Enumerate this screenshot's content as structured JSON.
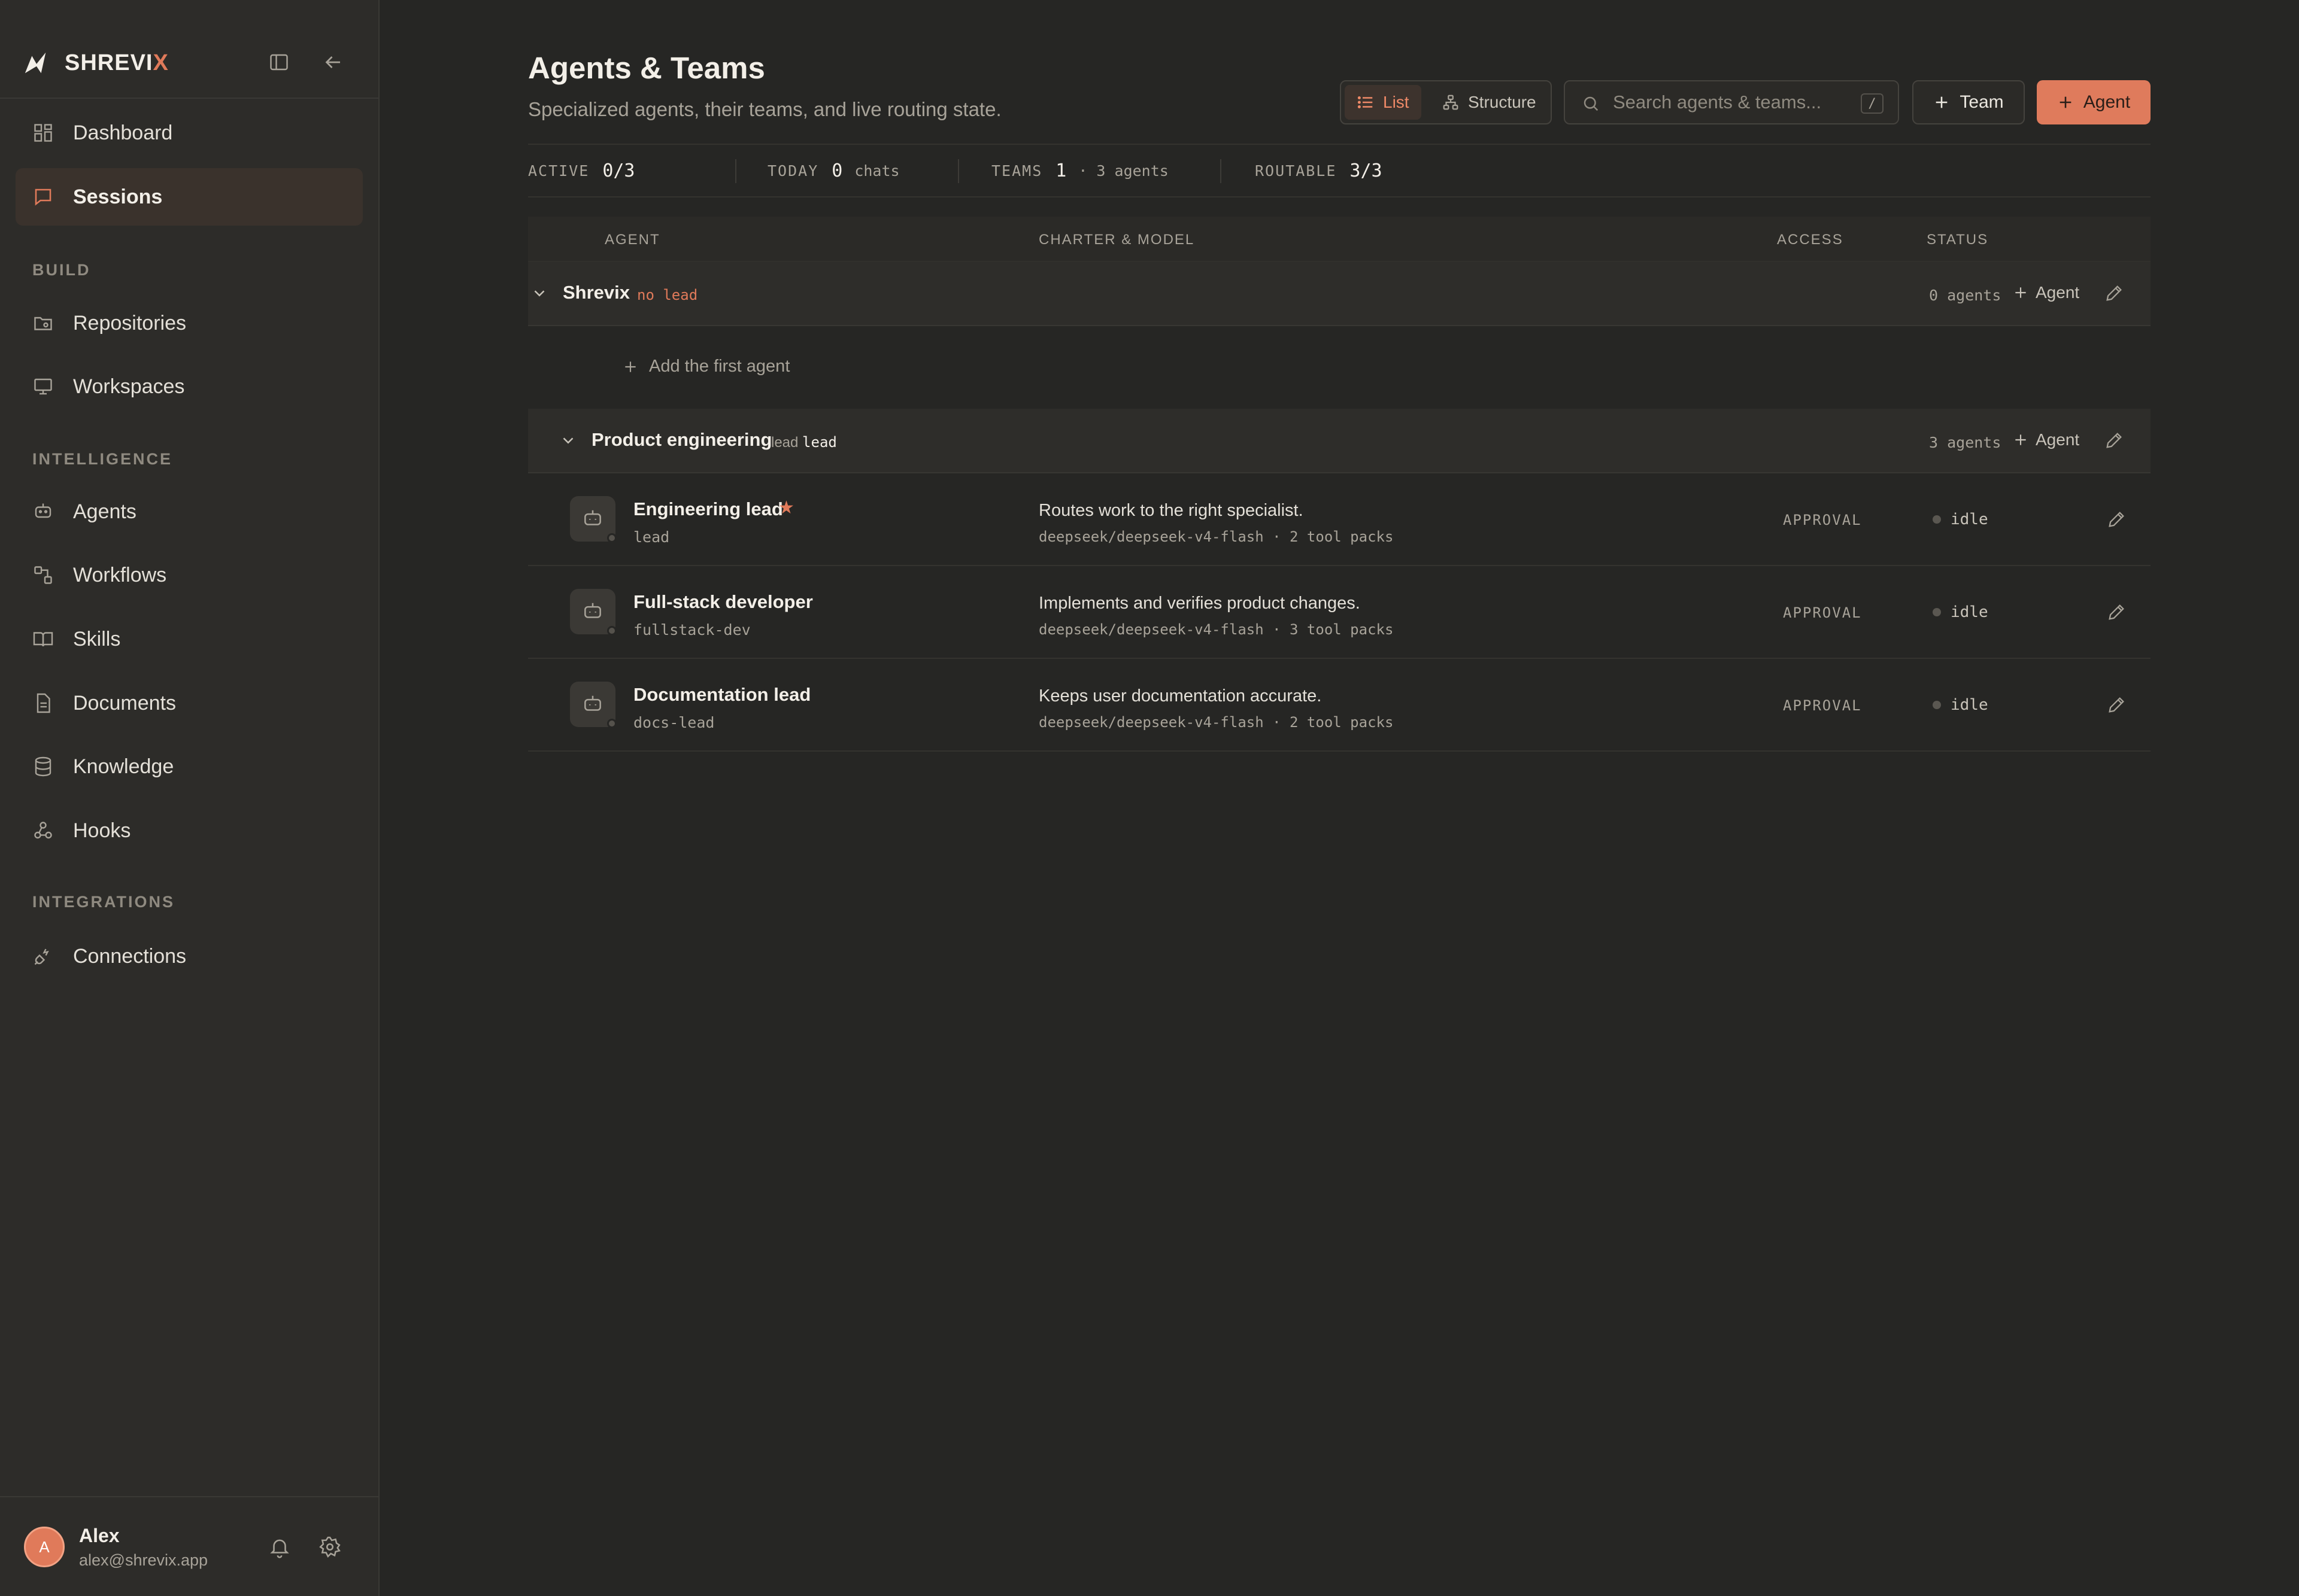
{
  "sidebar": {
    "brand": {
      "name_main": "SHREVI",
      "name_accent": "X"
    },
    "items": [
      {
        "label": "Dashboard"
      },
      {
        "label": "Sessions"
      },
      {
        "label": "Repositories"
      },
      {
        "label": "Workspaces"
      },
      {
        "label": "Agents"
      },
      {
        "label": "Workflows"
      },
      {
        "label": "Skills"
      },
      {
        "label": "Documents"
      },
      {
        "label": "Knowledge"
      },
      {
        "label": "Hooks"
      },
      {
        "label": "Connections"
      }
    ],
    "sections": {
      "build": "BUILD",
      "intelligence": "INTELLIGENCE",
      "integrations": "INTEGRATIONS"
    },
    "user": {
      "initial": "A",
      "name": "Alex",
      "email": "alex@shrevix.app"
    }
  },
  "header": {
    "title": "Agents & Teams",
    "subtitle": "Specialized agents, their teams, and live routing state.",
    "view_toggle": {
      "list": "List",
      "structure": "Structure"
    },
    "search": {
      "placeholder": "Search agents & teams...",
      "shortcut": "/"
    },
    "team_button": "Team",
    "agent_button": "Agent"
  },
  "stats": {
    "active": {
      "label": "ACTIVE",
      "value": "0/3"
    },
    "today": {
      "label": "TODAY",
      "value": "0",
      "suffix": "chats"
    },
    "teams": {
      "label": "TEAMS",
      "value": "1",
      "suffix": "· 3 agents"
    },
    "routable": {
      "label": "ROUTABLE",
      "value": "3/3"
    }
  },
  "table": {
    "columns": {
      "agent": "AGENT",
      "charter": "CHARTER & MODEL",
      "access": "ACCESS",
      "status": "STATUS"
    },
    "teams": [
      {
        "name": "Shrevix",
        "lead": "no lead",
        "count": "0 agents",
        "add_label": "Agent",
        "empty_label": "Add the first agent"
      },
      {
        "name": "Product engineering",
        "lead_key": "lead",
        "lead_value": "lead",
        "count": "3 agents",
        "add_label": "Agent"
      }
    ],
    "agents": [
      {
        "name": "Engineering lead",
        "star": "★",
        "handle": "lead",
        "charter": "Routes work to the right specialist.",
        "model": "deepseek/deepseek-v4-flash · 2 tool packs",
        "access": "APPROVAL",
        "status": "idle"
      },
      {
        "name": "Full-stack developer",
        "handle": "fullstack-dev",
        "charter": "Implements and verifies product changes.",
        "model": "deepseek/deepseek-v4-flash · 3 tool packs",
        "access": "APPROVAL",
        "status": "idle"
      },
      {
        "name": "Documentation lead",
        "handle": "docs-lead",
        "charter": "Keeps user documentation accurate.",
        "model": "deepseek/deepseek-v4-flash · 2 tool packs",
        "access": "APPROVAL",
        "status": "idle"
      }
    ]
  },
  "colors": {
    "accent": "#df7b5c",
    "background": "#262624",
    "sidebar": "#2d2c29"
  }
}
